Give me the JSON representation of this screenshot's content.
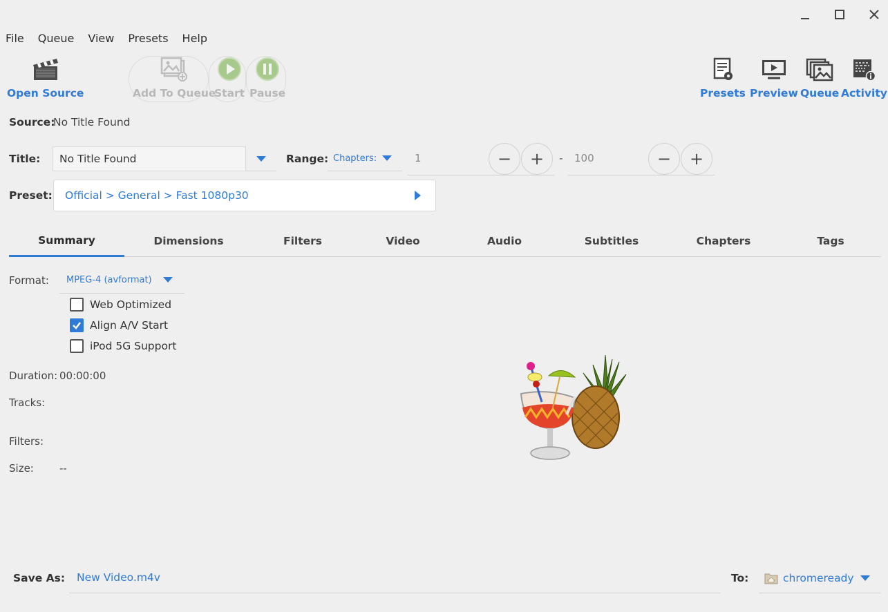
{
  "window": {
    "minimize_icon": "minimize-icon",
    "maximize_icon": "maximize-icon",
    "close_icon": "close-icon"
  },
  "menu": [
    "File",
    "Queue",
    "View",
    "Presets",
    "Help"
  ],
  "toolbar": {
    "open_source": "Open Source",
    "add_to_queue": "Add To Queue",
    "start": "Start",
    "pause": "Pause",
    "presets": "Presets",
    "preview": "Preview",
    "queue": "Queue",
    "activity": "Activity"
  },
  "source": {
    "label": "Source:",
    "value": "No Title Found"
  },
  "title": {
    "label": "Title:",
    "value": "No Title Found"
  },
  "range": {
    "label": "Range:",
    "mode": "Chapters:",
    "start": "1",
    "separator": "-",
    "end": "100"
  },
  "preset": {
    "label": "Preset:",
    "value": "Official > General > Fast 1080p30"
  },
  "tabs": [
    "Summary",
    "Dimensions",
    "Filters",
    "Video",
    "Audio",
    "Subtitles",
    "Chapters",
    "Tags"
  ],
  "summary": {
    "format_label": "Format:",
    "format_value": "MPEG-4 (avformat)",
    "options": [
      {
        "label": "Web Optimized",
        "checked": false
      },
      {
        "label": "Align A/V Start",
        "checked": true
      },
      {
        "label": "iPod 5G Support",
        "checked": false
      }
    ],
    "duration_label": "Duration:",
    "duration_value": "00:00:00",
    "tracks_label": "Tracks:",
    "filters_label": "Filters:",
    "size_label": "Size:",
    "size_value": "--"
  },
  "save": {
    "label": "Save As:",
    "filename": "New Video.m4v",
    "to_label": "To:",
    "folder": "chromeready"
  },
  "colors": {
    "accent": "#2f7bd6",
    "background": "#efefef"
  }
}
